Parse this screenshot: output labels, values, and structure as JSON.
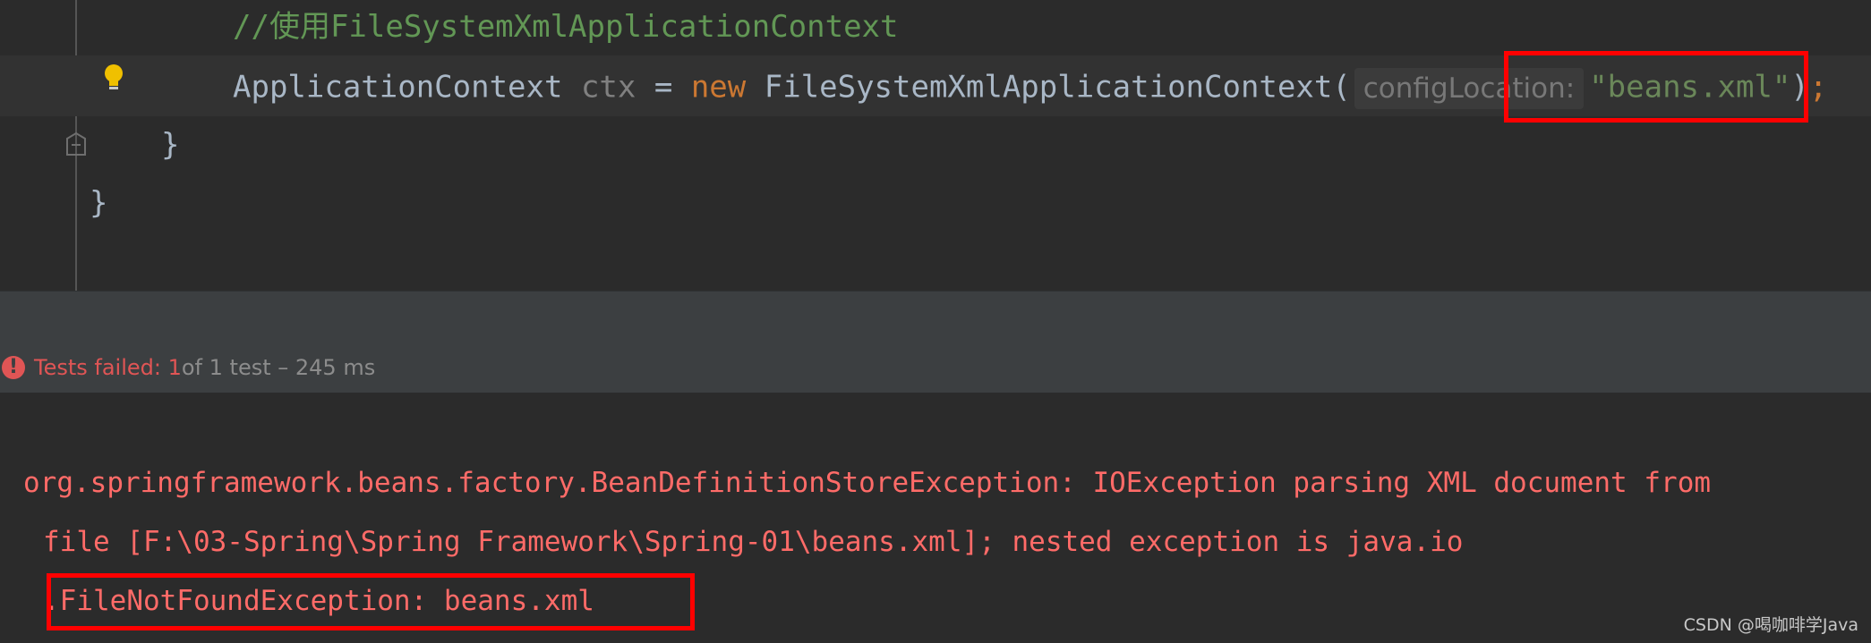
{
  "editor": {
    "comment_line": "//使用FileSystemXmlApplicationContext",
    "code": {
      "type": "ApplicationContext",
      "var": "ctx",
      "assign": "=",
      "new_kw": "new",
      "ctor": "FileSystemXmlApplicationContext(",
      "hint": "configLocation:",
      "arg": "\"beans.xml\"",
      "close": ")",
      "semicolon": ";"
    },
    "brace_inner": "}",
    "brace_outer": "}"
  },
  "test_status": {
    "failed_text": "Tests failed: 1",
    "rest_text": " of 1 test – 245 ms",
    "icon": "error-icon"
  },
  "console": {
    "line1": "org.springframework.beans.factory.BeanDefinitionStoreException: IOException parsing XML document from",
    "line2": "file [F:\\03-Spring\\Spring Framework\\Spring-01\\beans.xml]; nested exception is java.io",
    "line3": ".FileNotFoundException: beans.xml"
  },
  "watermark": "CSDN @喝咖啡学Java",
  "colors": {
    "background": "#2b2b2b",
    "error": "#ff6b68",
    "annotation_box": "#ff0000"
  }
}
